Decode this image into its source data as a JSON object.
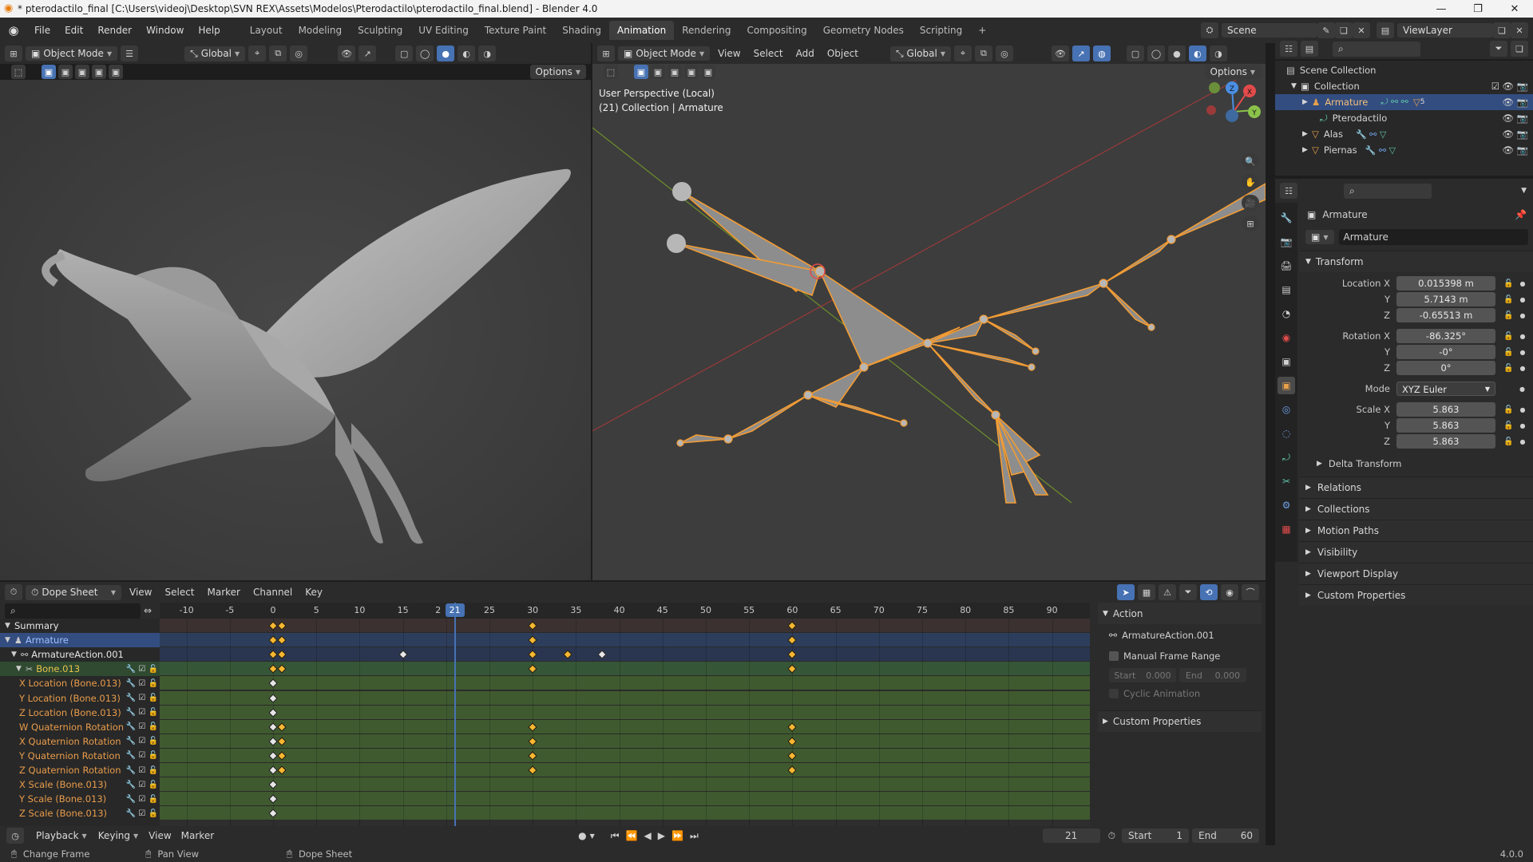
{
  "window": {
    "title": "* pterodactilo_final [C:\\Users\\videoj\\Desktop\\SVN REX\\Assets\\Modelos\\Pterodactilo\\pterodactilo_final.blend] - Blender 4.0"
  },
  "topbar": {
    "menus": [
      "File",
      "Edit",
      "Render",
      "Window",
      "Help"
    ],
    "workspaces": [
      "Layout",
      "Modeling",
      "Sculpting",
      "UV Editing",
      "Texture Paint",
      "Shading",
      "Animation",
      "Rendering",
      "Compositing",
      "Geometry Nodes",
      "Scripting"
    ],
    "active_workspace": "Animation",
    "add_tab": "+",
    "scene": "Scene",
    "view_layer": "ViewLayer"
  },
  "left_viewport": {
    "mode": "Object Mode",
    "orientation": "Global",
    "options": "Options"
  },
  "right_viewport": {
    "mode": "Object Mode",
    "menus": [
      "View",
      "Select",
      "Add",
      "Object"
    ],
    "orientation": "Global",
    "options": "Options",
    "overlay_line1": "User Perspective (Local)",
    "overlay_line2": "(21) Collection | Armature",
    "gizmo": {
      "x": "X",
      "y": "Y",
      "z": "Z"
    }
  },
  "outliner": {
    "root": "Scene Collection",
    "rows": [
      {
        "name": "Collection",
        "indent": 1
      },
      {
        "name": "Armature",
        "indent": 2,
        "selected": true,
        "count": "5"
      },
      {
        "name": "Pterodactilo",
        "indent": 3
      },
      {
        "name": "Alas",
        "indent": 2
      },
      {
        "name": "Piernas",
        "indent": 2
      }
    ]
  },
  "properties": {
    "object_name": "Armature",
    "data_name": "Armature",
    "transform_header": "Transform",
    "location_label": "Location X",
    "rotation_label": "Rotation X",
    "scale_label": "Scale X",
    "axis_y": "Y",
    "axis_z": "Z",
    "location": [
      "0.015398 m",
      "5.7143 m",
      "-0.65513 m"
    ],
    "rotation": [
      "-86.325°",
      "-0°",
      "0°"
    ],
    "mode_label": "Mode",
    "mode_value": "XYZ Euler",
    "scale": [
      "5.863",
      "5.863",
      "5.863"
    ],
    "delta": "Delta Transform",
    "panels": [
      "Relations",
      "Collections",
      "Motion Paths",
      "Visibility",
      "Viewport Display",
      "Custom Properties"
    ]
  },
  "dopesheet": {
    "editor": "Dope Sheet",
    "menus": [
      "View",
      "Select",
      "Marker",
      "Channel",
      "Key"
    ],
    "current_frame": "21",
    "ruler": [
      "-10",
      "-5",
      "0",
      "5",
      "10",
      "15",
      "2",
      "25",
      "30",
      "35",
      "40",
      "45",
      "50",
      "55",
      "60",
      "65",
      "70",
      "75",
      "80",
      "85",
      "90"
    ],
    "channels": [
      {
        "name": "Summary",
        "type": "summary"
      },
      {
        "name": "Armature",
        "type": "object"
      },
      {
        "name": "ArmatureAction.001",
        "type": "action"
      },
      {
        "name": "Bone.013",
        "type": "group"
      },
      {
        "name": "X Location (Bone.013)",
        "type": "fcurve"
      },
      {
        "name": "Y Location (Bone.013)",
        "type": "fcurve"
      },
      {
        "name": "Z Location (Bone.013)",
        "type": "fcurve"
      },
      {
        "name": "W Quaternion Rotation (I",
        "type": "fcurve"
      },
      {
        "name": "X Quaternion Rotation (E",
        "type": "fcurve"
      },
      {
        "name": "Y Quaternion Rotation (E",
        "type": "fcurve"
      },
      {
        "name": "Z Quaternion Rotation (E",
        "type": "fcurve"
      },
      {
        "name": "X Scale (Bone.013)",
        "type": "fcurve"
      },
      {
        "name": "Y Scale (Bone.013)",
        "type": "fcurve"
      },
      {
        "name": "Z Scale (Bone.013)",
        "type": "fcurve"
      }
    ],
    "keyframes": [
      [
        [
          0,
          "sel"
        ],
        [
          1,
          "sel"
        ],
        [
          30,
          "sel"
        ],
        [
          60,
          "sel"
        ]
      ],
      [
        [
          0,
          "sel"
        ],
        [
          1,
          "sel"
        ],
        [
          30,
          "sel"
        ],
        [
          60,
          "sel"
        ]
      ],
      [
        [
          0,
          "sel"
        ],
        [
          1,
          "sel"
        ],
        [
          15,
          "un"
        ],
        [
          30,
          "sel"
        ],
        [
          34,
          "sel"
        ],
        [
          38,
          "un"
        ],
        [
          60,
          "sel"
        ]
      ],
      [
        [
          0,
          "sel"
        ],
        [
          1,
          "sel"
        ],
        [
          30,
          "sel"
        ],
        [
          60,
          "sel"
        ]
      ],
      [
        [
          0,
          "un"
        ]
      ],
      [
        [
          0,
          "un"
        ]
      ],
      [
        [
          0,
          "un"
        ]
      ],
      [
        [
          0,
          "un"
        ],
        [
          1,
          "sel"
        ],
        [
          30,
          "sel"
        ],
        [
          60,
          "sel"
        ]
      ],
      [
        [
          0,
          "un"
        ],
        [
          1,
          "sel"
        ],
        [
          30,
          "sel"
        ],
        [
          60,
          "sel"
        ]
      ],
      [
        [
          0,
          "un"
        ],
        [
          1,
          "sel"
        ],
        [
          30,
          "sel"
        ],
        [
          60,
          "sel"
        ]
      ],
      [
        [
          0,
          "un"
        ],
        [
          1,
          "sel"
        ],
        [
          30,
          "sel"
        ],
        [
          60,
          "sel"
        ]
      ],
      [
        [
          0,
          "un"
        ]
      ],
      [
        [
          0,
          "un"
        ]
      ],
      [
        [
          0,
          "un"
        ]
      ]
    ],
    "action_panel": {
      "header": "Action",
      "action_name": "ArmatureAction.001",
      "manual_range": "Manual Frame Range",
      "start_label": "Start",
      "start_value": "0.000",
      "end_label": "End",
      "end_value": "0.000",
      "cyclic": "Cyclic Animation",
      "custom_props": "Custom Properties"
    }
  },
  "timeline": {
    "menus": [
      "Playback",
      "Keying",
      "View",
      "Marker"
    ],
    "frame": "21",
    "start_label": "Start",
    "start": "1",
    "end_label": "End",
    "end": "60"
  },
  "statusbar": {
    "items": [
      "Change Frame",
      "Pan View",
      "Dope Sheet"
    ],
    "version": "4.0.0"
  },
  "colors": {
    "selected": "#4772b3",
    "keyframe_selected": "#f7b731",
    "bone_outline": "#f39c34",
    "playhead": "#4772b3"
  }
}
